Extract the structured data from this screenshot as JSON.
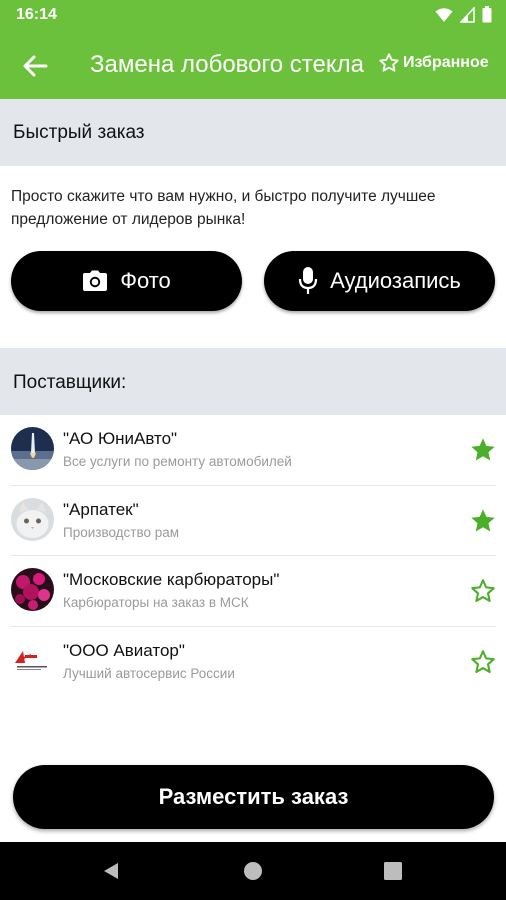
{
  "status_bar": {
    "time": "16:14"
  },
  "app_bar": {
    "title": "Замена лобового стекла",
    "favorites_label": "Избранное"
  },
  "quick_order": {
    "header": "Быстрый заказ",
    "intro": "Просто скажите что вам нужно, и быстро получите лучшее предложение от лидеров рынка!",
    "photo_label": "Фото",
    "audio_label": "Аудиозапись"
  },
  "suppliers": {
    "header": "Поставщики:",
    "items": [
      {
        "name": "\"АО ЮниАвто\"",
        "description": "Все услуги по ремонту автомобилей",
        "favorite": true,
        "avatar_icon": "rocket-launch-avatar"
      },
      {
        "name": "\"Арпатек\"",
        "description": "Производство рам",
        "favorite": true,
        "avatar_icon": "cat-avatar"
      },
      {
        "name": "\"Московские карбюраторы\"",
        "description": "Карбюраторы на заказ в МСК",
        "favorite": false,
        "avatar_icon": "flowers-avatar"
      },
      {
        "name": "\"ООО Авиатор\"",
        "description": "Лучший автосервис России",
        "favorite": false,
        "avatar_icon": "aviator-logo-avatar"
      }
    ]
  },
  "order_button_label": "Разместить заказ",
  "colors": {
    "accent": "#6cc13c",
    "section_bg": "#e3e7ec",
    "button_bg": "#000000"
  }
}
